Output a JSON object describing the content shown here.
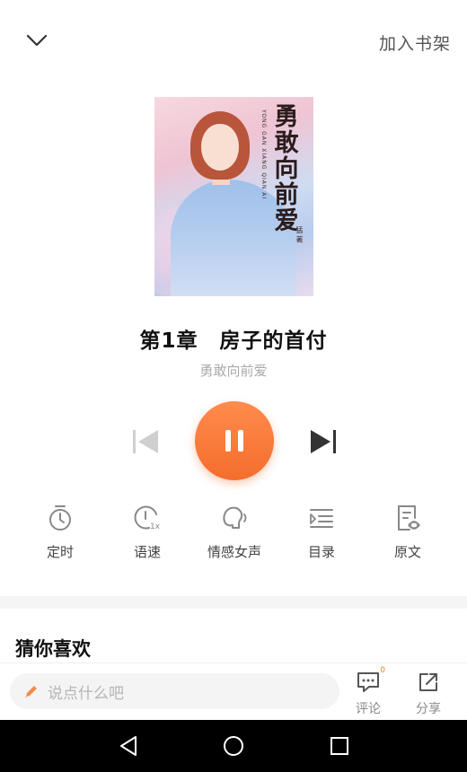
{
  "header": {
    "add_to_shelf": "加入书架"
  },
  "cover": {
    "title_chars": [
      "勇",
      "敢",
      "向",
      "前",
      "爱"
    ],
    "pinyin": "YONG GAN XIANG QIAN AI",
    "author_mark": "猛 著"
  },
  "player": {
    "chapter_title": "第1章　房子的首付",
    "book_name": "勇敢向前爱",
    "accent": "#f46d2c",
    "state": "playing"
  },
  "functions": [
    {
      "label": "定时",
      "icon": "timer-icon"
    },
    {
      "label": "语速",
      "icon": "speed-icon"
    },
    {
      "label": "情感女声",
      "icon": "voice-icon"
    },
    {
      "label": "目录",
      "icon": "catalog-icon"
    },
    {
      "label": "原文",
      "icon": "original-text-icon"
    }
  ],
  "recommend": {
    "title": "猜你喜欢"
  },
  "bottom": {
    "comment_placeholder": "说点什么吧",
    "comment_label": "评论",
    "comment_count": "0",
    "share_label": "分享"
  }
}
